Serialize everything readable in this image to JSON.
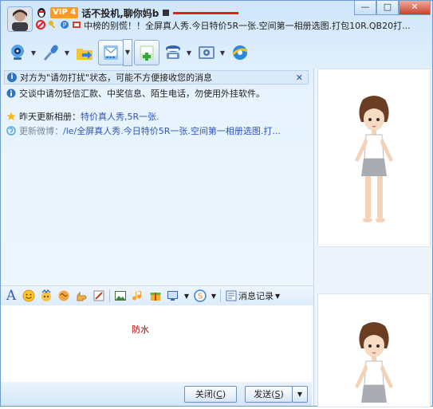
{
  "title": {
    "vip_badge": "VIP 4",
    "nickname": "话不投机,聊你妈b",
    "signature": "中榜的别慌！！全屏真人秀.今日特价5R一张.空间第一相册选图.打包10R.QB20打..."
  },
  "window_controls": {
    "minimize": "—",
    "maximize": "□",
    "close": "✕"
  },
  "toolbar": {
    "icons": [
      "video-call-icon",
      "voice-call-icon",
      "send-file-icon",
      "send-sms-icon",
      "invite-icon",
      "remote-assist-icon",
      "app-settings-icon",
      "browser-icon"
    ]
  },
  "infobar": {
    "text": "对方为\"请勿打扰\"状态，可能不方便接收您的消息",
    "close": "✕"
  },
  "messages": {
    "warning": "交谈中请勿轻信汇款、中奖信息、陌生电话，勿使用外挂软件。",
    "album_label": "昨天更新相册：",
    "album_link": "特价真人秀,5R一张.",
    "weibo_label": "更新微博：",
    "weibo_link": "/le/全屏真人秀.今日特价5R一张.空间第一相册选图.打..."
  },
  "format_toolbar": {
    "font_button": "A",
    "record_label": "消息记录"
  },
  "input": {
    "text": "防水"
  },
  "buttons": {
    "close": "关闭(C)",
    "close_text": "关闭(",
    "close_key": "C",
    "send_text": "发送(",
    "send_key": "S",
    "paren": ")",
    "more": "▼"
  },
  "colors": {
    "input_text": "#c00000",
    "link": "#2d55b8",
    "accent": "#2f72c4"
  }
}
